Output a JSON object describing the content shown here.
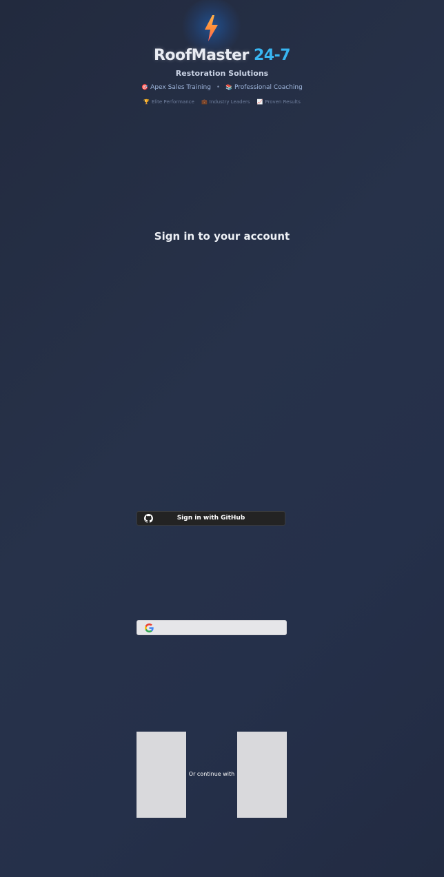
{
  "brand": {
    "name_main": "RoofMaster",
    "name_accent": "24-7",
    "subtitle": "Restoration Solutions",
    "accent_color": "#38b6f2",
    "logo_icon": "lightning-bolt-icon"
  },
  "features": [
    {
      "icon": "target-icon",
      "glyph": "🎯",
      "label": "Apex Sales Training"
    },
    {
      "icon": "books-icon",
      "glyph": "📚",
      "label": "Professional Coaching"
    }
  ],
  "features_separator": "•",
  "badges": [
    {
      "icon": "trophy-icon",
      "glyph": "🏆",
      "label": "Elite Performance"
    },
    {
      "icon": "briefcase-icon",
      "glyph": "💼",
      "label": "Industry Leaders"
    },
    {
      "icon": "chart-icon",
      "glyph": "📈",
      "label": "Proven Results"
    }
  ],
  "auth": {
    "title": "Sign in to your account",
    "github_label": "Sign in with GitHub",
    "google_label": "",
    "divider_text": "Or continue with"
  }
}
